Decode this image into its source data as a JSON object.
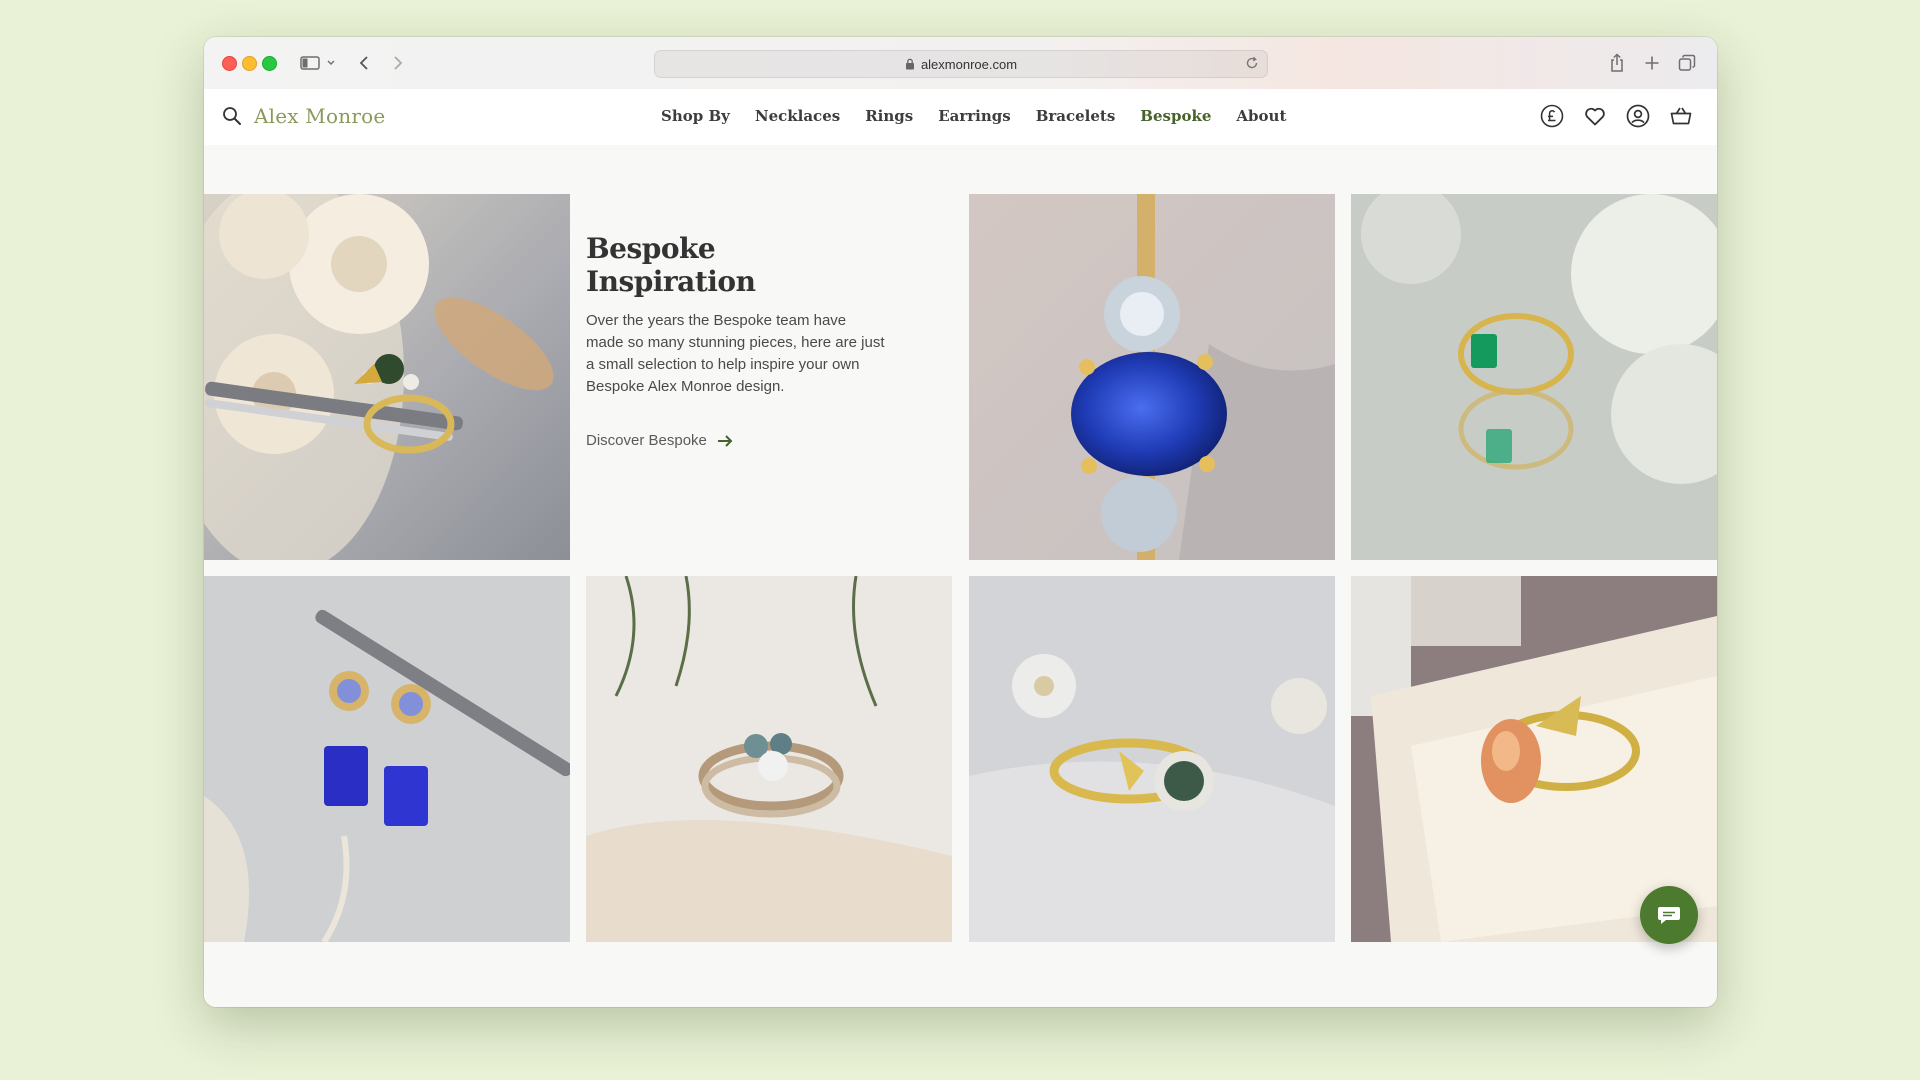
{
  "browser": {
    "url": "alexmonroe.com"
  },
  "header": {
    "logo": "Alex Monroe",
    "nav": [
      {
        "label": "Shop By"
      },
      {
        "label": "Necklaces"
      },
      {
        "label": "Rings"
      },
      {
        "label": "Earrings"
      },
      {
        "label": "Bracelets"
      },
      {
        "label": "Bespoke",
        "active": true
      },
      {
        "label": "About"
      }
    ],
    "icons": [
      "currency-pound-icon",
      "heart-icon",
      "account-icon",
      "basket-icon"
    ]
  },
  "intro": {
    "title": "Bespoke Inspiration",
    "body": "Over the years the Bespoke team have made so many stunning pieces, here are just a small selection to help inspire your own Bespoke Alex Monroe design.",
    "link_label": "Discover Bespoke"
  },
  "gallery": [
    {
      "name": "green-sapphire-ring-tweezers-photo"
    },
    {
      "name": "blue-sapphire-trilogy-ring-photo"
    },
    {
      "name": "emerald-ring-reflection-photo"
    },
    {
      "name": "tanzanite-drop-earrings-photo"
    },
    {
      "name": "sapphire-cluster-ring-stack-photo"
    },
    {
      "name": "green-sapphire-halo-ring-photo"
    },
    {
      "name": "peach-sapphire-ring-box-photo"
    }
  ],
  "colors": {
    "accent": "#47622a",
    "logo": "#8a9a5b",
    "chat": "#4c7a2f",
    "background": "#e9f1d6"
  }
}
